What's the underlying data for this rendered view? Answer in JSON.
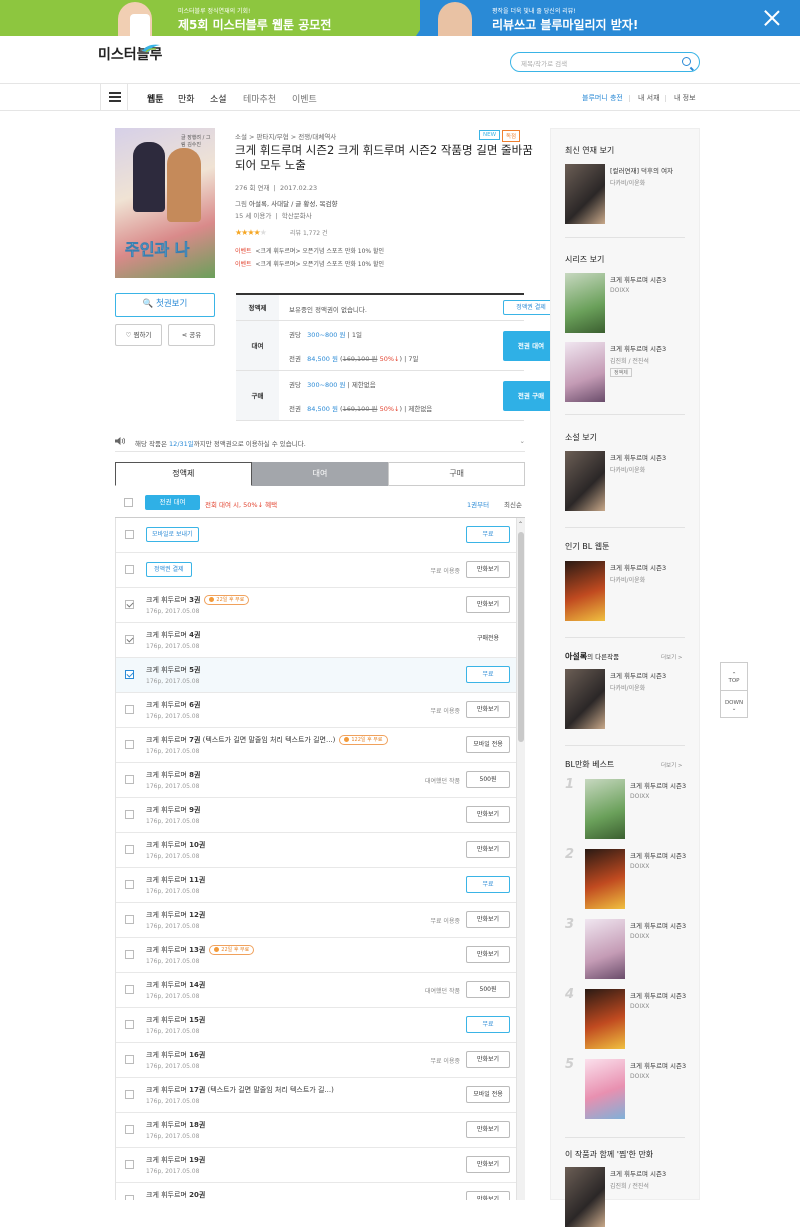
{
  "banner": {
    "left_small": "미스터블루 정식연재의 기회!",
    "left_big": "제5회 미스터블루 웹툰 공모전",
    "right_small": "평작을 더욱 빛내 줄 당신의 리뷰!",
    "right_big": "리뷰쓰고 블루마일리지 받자!"
  },
  "header": {
    "logo": "미스터블루",
    "search_placeholder": "제목/작가로 검색"
  },
  "nav": {
    "items": [
      "웹툰",
      "만화",
      "소설",
      "테마추천",
      "이벤트"
    ],
    "right": [
      "블루머니 충전",
      "내 서재",
      "내 정보"
    ]
  },
  "book": {
    "cover_title": "주인과 나",
    "cover_credit": "글 장행려 / 그림 김수진",
    "badges": [
      "NEW",
      "독점"
    ],
    "breadcrumb": "소설 > 판타지/무협 > 전쟁/대체역사",
    "title": "크게 휘드루며 시즌2 크게 휘드루며 시즌2 작품명 길면 줄바꿈되어 모두 노출",
    "volumes": "276 회 연재",
    "date": "2017.02.23",
    "authors_prefix": "그림",
    "authors": "아설록, 사대달 / 글 황성, 목검향",
    "age": "15 세 이용가",
    "publisher": "학산문화사",
    "rating": "★★★★",
    "rating_off": "★",
    "reviews": "리뷰 1,772 건",
    "events": [
      {
        "tag": "이벤트",
        "text": "<크게 휘두르며> 오픈기념 스포츠 만화 10% 할인"
      },
      {
        "tag": "이벤트",
        "text": "<크게 휘두르며> 오픈기념 스포츠 만화 10% 할인"
      }
    ]
  },
  "actions": {
    "first_view": "첫권보기",
    "zzim": "찜하기",
    "share": "공유"
  },
  "pricing": {
    "sub_label": "정액제",
    "sub_text": "보유중인 정액권이 없습니다.",
    "sub_btn": "정액권 결제",
    "rent_label": "대여",
    "rent_row1": {
      "a": "권당",
      "b": "300~800 원",
      "c": "1일"
    },
    "rent_row2": {
      "a": "전권",
      "b": "84,500 원",
      "c": "169,100 원",
      "d": "50%↓",
      "e": "7일"
    },
    "rent_btn": "전권 대여",
    "buy_label": "구매",
    "buy_row1": {
      "a": "권당",
      "b": "300~800 원",
      "c": "제한없음"
    },
    "buy_row2": {
      "a": "전권",
      "b": "84,500 원",
      "c": "169,100 원",
      "d": "50%↓",
      "e": "제한없음"
    },
    "buy_btn": "전권 구매"
  },
  "notice": {
    "pre": "해당 작품은 ",
    "date": "12/31일",
    "post": "까지만 정액권으로 이용하실 수 있습니다."
  },
  "tabs": [
    "정액제",
    "대여",
    "구매"
  ],
  "list_header": {
    "btn": "전권 대여",
    "promo": "전회 대여 시, 50%↓ 혜택",
    "sort1": "1권부터",
    "sort2": "최신순"
  },
  "top_rows": [
    {
      "btn_left": "모바일로 보내기",
      "btn": "무료"
    },
    {
      "btn_left": "정액권 결제",
      "status": "무료 이용중",
      "btn": "만화보기"
    }
  ],
  "episodes": [
    {
      "title": "크게 휘두르며 ",
      "num": "3권",
      "sub": "176p, 2017.05.08",
      "free": "22일 후 무료",
      "btn": "만화보기",
      "check": "grey"
    },
    {
      "title": "크게 휘두르며 ",
      "num": "4권",
      "sub": "176p, 2017.05.08",
      "btn": "구매전용",
      "btnstyle": "plain",
      "check": "grey"
    },
    {
      "title": "크게 휘두르며 ",
      "num": "5권",
      "sub": "176p, 2017.05.08",
      "btn": "무료",
      "btnstyle": "blue",
      "check": "blue",
      "hl": true
    },
    {
      "title": "크게 휘두르며 ",
      "num": "6권",
      "sub": "176p, 2017.05.08",
      "status": "무료 이용중",
      "btn": "만화보기"
    },
    {
      "title": "크게 휘두르며 ",
      "num": "7권",
      "extra": " (텍스트가 길면 말줄임 처리 텍스트가 길면...)",
      "sub": "176p, 2017.05.08",
      "free": "122일 후 무료",
      "btn": "모바일 전용"
    },
    {
      "title": "크게 휘두르며 ",
      "num": "8권",
      "sub": "176p, 2017.05.08",
      "status": "대여했던 작품",
      "btn": "500원"
    },
    {
      "title": "크게 휘두르며 ",
      "num": "9권",
      "sub": "176p, 2017.05.08",
      "btn": "만화보기"
    },
    {
      "title": "크게 휘두르며 ",
      "num": "10권",
      "sub": "176p, 2017.05.08",
      "btn": "만화보기"
    },
    {
      "title": "크게 휘두르며 ",
      "num": "11권",
      "sub": "176p, 2017.05.08",
      "btn": "무료",
      "btnstyle": "blue"
    },
    {
      "title": "크게 휘두르며 ",
      "num": "12권",
      "sub": "176p, 2017.05.08",
      "status": "무료 이용중",
      "btn": "만화보기"
    },
    {
      "title": "크게 휘두르며 ",
      "num": "13권",
      "sub": "176p, 2017.05.08",
      "free": "22일 후 무료",
      "btn": "만화보기"
    },
    {
      "title": "크게 휘두르며 ",
      "num": "14권",
      "sub": "176p, 2017.05.08",
      "status": "대여했던 작품",
      "btn": "500원"
    },
    {
      "title": "크게 휘두르며 ",
      "num": "15권",
      "sub": "176p, 2017.05.08",
      "btn": "무료",
      "btnstyle": "blue"
    },
    {
      "title": "크게 휘두르며 ",
      "num": "16권",
      "sub": "176p, 2017.05.08",
      "status": "무료 이용중",
      "btn": "만화보기"
    },
    {
      "title": "크게 휘두르며 ",
      "num": "17권",
      "extra": " (텍스트가 길면 말줄임 처리 텍스트가 길...)",
      "sub": "176p, 2017.05.08",
      "btn": "모바일 전용"
    },
    {
      "title": "크게 휘두르며 ",
      "num": "18권",
      "sub": "176p, 2017.05.08",
      "btn": "만화보기"
    },
    {
      "title": "크게 휘두르며 ",
      "num": "19권",
      "sub": "176p, 2017.05.08",
      "btn": "만화보기"
    },
    {
      "title": "크게 휘두르며 ",
      "num": "20권",
      "sub": "176p, 2017.05.08",
      "btn": "만화보기"
    }
  ],
  "sidebar": {
    "recent": {
      "title": "최신 연재 보기",
      "item": {
        "t": "[컬러연재] 덕후의 여자",
        "a": "다카비/이윤화"
      }
    },
    "series": {
      "title": "시리즈 보기",
      "items": [
        {
          "t": "크게 휘두르며 시즌3",
          "a": "DOIXX"
        },
        {
          "t": "크게 휘두르며 시즌3",
          "a": "김진희 / 전진석",
          "tag": "정액제"
        }
      ]
    },
    "novel": {
      "title": "소설 보기",
      "item": {
        "t": "크게 휘두르며 시즌3",
        "a": "다카비/이윤화"
      }
    },
    "bl": {
      "title": "인기 BL 웹툰",
      "item": {
        "t": "크게 휘두르며 시즌3",
        "a": "다카비/이윤화"
      }
    },
    "author": {
      "title_b": "아설록",
      "title_r": "의 다른작품",
      "more": "더보기 >",
      "item": {
        "t": "크게 휘두르며 시즌3",
        "a": "다카비/이윤화"
      }
    },
    "best": {
      "title": "BL만화 베스트",
      "more": "더보기 >",
      "items": [
        {
          "r": "1",
          "t": "크게 휘두르며 시즌3",
          "a": "DOIXX"
        },
        {
          "r": "2",
          "t": "크게 휘두르며 시즌3",
          "a": "DOIXX"
        },
        {
          "r": "3",
          "t": "크게 휘두르며 시즌3",
          "a": "DOIXX"
        },
        {
          "r": "4",
          "t": "크게 휘두르며 시즌3",
          "a": "DOIXX"
        },
        {
          "r": "5",
          "t": "크게 휘두르며 시즌3",
          "a": "DOIXX"
        }
      ]
    },
    "together": {
      "title": "이 작품과 함께 '찜'한 만화",
      "item": {
        "t": "크게 휘두르며 시즌3",
        "a": "김진희 / 전진석"
      }
    }
  },
  "float": {
    "top": "TOP",
    "down": "DOWN"
  }
}
